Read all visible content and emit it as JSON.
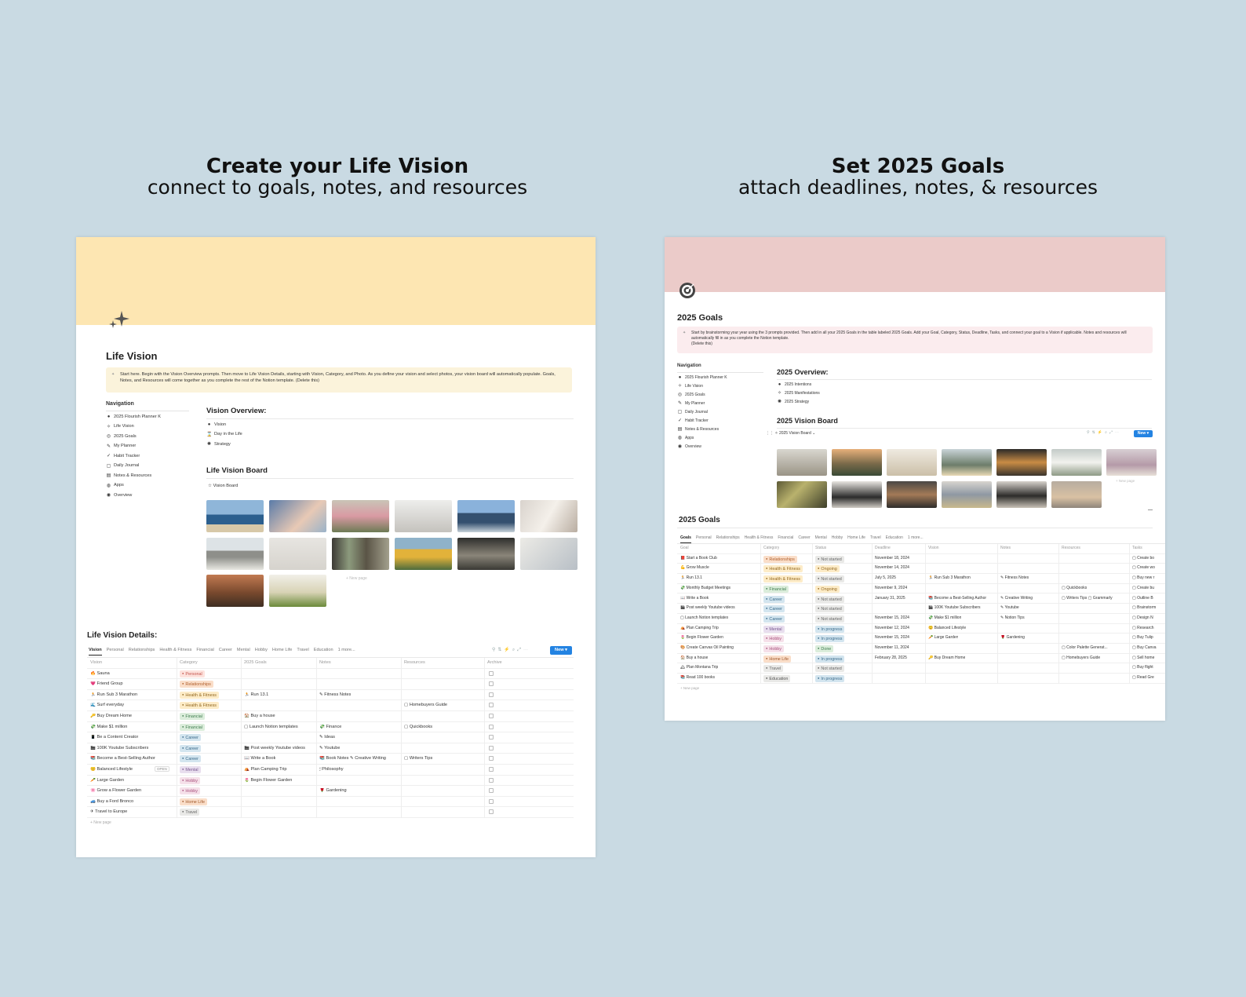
{
  "left_heading": {
    "title": "Create your Life Vision",
    "subtitle": "connect to goals, notes, and resources"
  },
  "right_heading": {
    "title": "Set 2025 Goals",
    "subtitle": "attach deadlines, notes, & resources"
  },
  "colors": {
    "cover_left": "#fde6b2",
    "cover_right": "#ebcbc9",
    "callout_left": "#fbf3db",
    "callout_right": "#fbecee",
    "accent": "#2383e2"
  },
  "tag_colors": {
    "Personal": {
      "bg": "#fde2dd",
      "fg": "#c4554d"
    },
    "Relationships": {
      "bg": "#fadec9",
      "fg": "#b0602e"
    },
    "Health & Fitness": {
      "bg": "#fdecc8",
      "fg": "#946922"
    },
    "Financial": {
      "bg": "#dbeddb",
      "fg": "#3f7d4f"
    },
    "Career": {
      "bg": "#d3e5ef",
      "fg": "#3a6a8a"
    },
    "Mental": {
      "bg": "#e8deee",
      "fg": "#7b5a92"
    },
    "Hobby": {
      "bg": "#f5e0e9",
      "fg": "#a9527e"
    },
    "Home Life": {
      "bg": "#fadec9",
      "fg": "#a0592c"
    },
    "Travel": {
      "bg": "#e9e9e7",
      "fg": "#666"
    },
    "Education": {
      "bg": "#e9e9e7",
      "fg": "#555"
    },
    "Not started": {
      "bg": "#e9e9e7",
      "fg": "#666"
    },
    "Ongoing": {
      "bg": "#fdecc8",
      "fg": "#946922"
    },
    "In progress": {
      "bg": "#d3e5ef",
      "fg": "#3a6a8a"
    },
    "Done": {
      "bg": "#dbeddb",
      "fg": "#3f7d4f"
    }
  },
  "left": {
    "page_icon": "sparkles-icon",
    "title": "Life Vision",
    "callout": "Start here. Begin with the Vision Overview prompts. Then move to Life Vision Details, starting with Vision, Category, and Photo. As you define your vision and select photos, your vision board will automatically populate. Goals, Notes, and Resources will come together as you complete the rest of the Notion template. (Delete this)",
    "nav_heading": "Navigation",
    "nav": [
      {
        "icon": "●",
        "label": "2025 Flourish Planner K"
      },
      {
        "icon": "✧",
        "label": "Life Vision"
      },
      {
        "icon": "◎",
        "label": "2025 Goals"
      },
      {
        "icon": "✎",
        "label": "My Planner"
      },
      {
        "icon": "✓",
        "label": "Habit Tracker"
      },
      {
        "icon": "▢",
        "label": "Daily Journal"
      },
      {
        "icon": "▤",
        "label": "Notes & Resources"
      },
      {
        "icon": "◍",
        "label": "Apps"
      },
      {
        "icon": "◉",
        "label": "Overview"
      }
    ],
    "overview_heading": "Vision Overview:",
    "overview_items": [
      {
        "icon": "●",
        "label": "Vision"
      },
      {
        "icon": "⌛",
        "label": "Day in the Life"
      },
      {
        "icon": "✺",
        "label": "Strategy"
      }
    ],
    "board_heading": "Life Vision Board",
    "board_view": "Vision Board",
    "new_page": "+ New page",
    "details_heading": "Life Vision Details:",
    "tabs": [
      "Vision",
      "Personal",
      "Relationships",
      "Health & Fitness",
      "Financial",
      "Career",
      "Mental",
      "Hobby",
      "Home Life",
      "Travel",
      "Education",
      "1 more..."
    ],
    "new_button": "New",
    "columns": [
      "Vision",
      "Category",
      "2025 Goals",
      "Notes",
      "Resources",
      "Archive"
    ],
    "rows": [
      {
        "icon": "🔥",
        "name": "Sauna",
        "category": "Personal",
        "goal": "",
        "notes": "",
        "resources": ""
      },
      {
        "icon": "💗",
        "name": "Friend Group",
        "category": "Relationships",
        "goal": "",
        "notes": "",
        "resources": ""
      },
      {
        "icon": "🏃",
        "name": "Run Sub 3 Marathon",
        "category": "Health & Fitness",
        "goal": "🏃 Run 13.1",
        "notes": "✎ Fitness Notes",
        "resources": ""
      },
      {
        "icon": "🌊",
        "name": "Surf everyday",
        "category": "Health & Fitness",
        "goal": "",
        "notes": "",
        "resources": "▢ Homebuyers Guide"
      },
      {
        "icon": "🔑",
        "name": "Buy Dream Home",
        "category": "Financial",
        "goal": "🏠 Buy a house",
        "notes": "",
        "resources": ""
      },
      {
        "icon": "💸",
        "name": "Make $1 million",
        "category": "Financial",
        "goal": "▢ Launch Notion templates",
        "notes": "💸 Finance",
        "resources": "▢ Quickbooks"
      },
      {
        "icon": "📱",
        "name": "Be a Content Creator",
        "category": "Career",
        "goal": "",
        "notes": "✎ Ideas",
        "resources": ""
      },
      {
        "icon": "🎬",
        "name": "100K Youtube Subscribers",
        "category": "Career",
        "goal": "🎬 Post weekly Youtube videos",
        "notes": "✎ Youtube",
        "resources": ""
      },
      {
        "icon": "📚",
        "name": "Become a Best-Selling Author",
        "category": "Career",
        "goal": "📖 Write a Book",
        "notes": "📚 Book Notes  ✎ Creative Writing",
        "resources": "▢ Writers Tips"
      },
      {
        "icon": "😊",
        "name": "Balanced Lifestyle",
        "category": "Mental",
        "goal": "⛺ Plan Camping Trip",
        "notes": "🕯 Philosophy",
        "resources": "",
        "open": "OPEN"
      },
      {
        "icon": "🥕",
        "name": "Large Garden",
        "category": "Hobby",
        "goal": "🌷 Begin Flower Garden",
        "notes": "",
        "resources": ""
      },
      {
        "icon": "🌸",
        "name": "Grow a Flower Garden",
        "category": "Hobby",
        "goal": "",
        "notes": "🌹 Gardening",
        "resources": ""
      },
      {
        "icon": "🚙",
        "name": "Buy a Ford Bronco",
        "category": "Home Life",
        "goal": "",
        "notes": "",
        "resources": ""
      },
      {
        "icon": "✈",
        "name": "Travel to Europe",
        "category": "Travel",
        "goal": "",
        "notes": "",
        "resources": ""
      }
    ]
  },
  "right": {
    "page_icon": "target-icon",
    "title": "2025 Goals",
    "callout": "Start by brainstorming your year using the 3 prompts provided. Then add in all your 2025 Goals in the table labeled 2025 Goals. Add your Goal, Category, Status, Deadline, Tasks, and connect your goal to a Vision if applicable. Notes and resources will automatically fill in as you complete the Notion template.",
    "callout_end": "(Delete this)",
    "nav_heading": "Navigation",
    "nav": [
      {
        "icon": "●",
        "label": "2025 Flourish Planner K"
      },
      {
        "icon": "✧",
        "label": "Life Vision"
      },
      {
        "icon": "◎",
        "label": "2025 Goals"
      },
      {
        "icon": "✎",
        "label": "My Planner"
      },
      {
        "icon": "▢",
        "label": "Daily Journal"
      },
      {
        "icon": "✓",
        "label": "Habit Tracker"
      },
      {
        "icon": "▤",
        "label": "Notes & Resources"
      },
      {
        "icon": "◍",
        "label": "Apps"
      },
      {
        "icon": "◉",
        "label": "Overview"
      }
    ],
    "overview_heading": "2025 Overview:",
    "overview_items": [
      {
        "icon": "●",
        "label": "2025 Intentions"
      },
      {
        "icon": "✧",
        "label": "2025 Manifestations"
      },
      {
        "icon": "✺",
        "label": "2025 Strategy"
      }
    ],
    "board_heading": "2025 Vision Board",
    "board_view": "2025 Vision Board",
    "new_button": "New",
    "new_page": "+ New page",
    "goals_heading": "2025 Goals",
    "tabs": [
      "Goals",
      "Personal",
      "Relationships",
      "Health & Fitness",
      "Financial",
      "Career",
      "Mental",
      "Hobby",
      "Home Life",
      "Travel",
      "Education",
      "1 more..."
    ],
    "columns": [
      "Goal",
      "Category",
      "Status",
      "Deadline",
      "Vision",
      "Notes",
      "Resources",
      "Tasks"
    ],
    "rows": [
      {
        "name": "Start a Book Club",
        "icon": "📕",
        "category": "Relationships",
        "status": "Not started",
        "deadline": "November 18, 2024",
        "vision": "",
        "notes": "",
        "resources": "",
        "tasks": "▢ Create bo"
      },
      {
        "name": "Grow Muscle",
        "icon": "💪",
        "category": "Health & Fitness",
        "status": "Ongoing",
        "deadline": "November 14, 2024",
        "vision": "",
        "notes": "",
        "resources": "",
        "tasks": "▢ Create wo"
      },
      {
        "name": "Run 13.1",
        "icon": "🏃",
        "category": "Health & Fitness",
        "status": "Not started",
        "deadline": "July 5, 2025",
        "vision": "🏃 Run Sub 3 Marathon",
        "notes": "✎ Fitness Notes",
        "resources": "",
        "tasks": "▢ Buy new r"
      },
      {
        "name": "Monthly Budget Meetings",
        "icon": "💸",
        "category": "Financial",
        "status": "Ongoing",
        "deadline": "November 9, 2024",
        "vision": "",
        "notes": "",
        "resources": "▢ Quickbooks",
        "tasks": "▢ Create bu"
      },
      {
        "name": "Write a Book",
        "icon": "📖",
        "category": "Career",
        "status": "Not started",
        "deadline": "January 31, 2025",
        "vision": "📚 Become a Best-Selling Author",
        "notes": "✎ Creative Writing",
        "resources": "▢ Writers Tips  ▢ Grammarly",
        "tasks": "▢ Outline B"
      },
      {
        "name": "Post weekly Youtube videos",
        "icon": "🎬",
        "category": "Career",
        "status": "Not started",
        "deadline": "",
        "vision": "🎬 100K Youtube Subscribers",
        "notes": "✎ Youtube",
        "resources": "",
        "tasks": "▢ Brainstorm"
      },
      {
        "name": "Launch Notion templates",
        "icon": "▢",
        "category": "Career",
        "status": "Not started",
        "deadline": "November 15, 2024",
        "vision": "💸 Make $1 million",
        "notes": "✎ Notion Tips",
        "resources": "",
        "tasks": "▢ Design N"
      },
      {
        "name": "Plan Camping Trip",
        "icon": "⛺",
        "category": "Mental",
        "status": "In progress",
        "deadline": "November 12, 2024",
        "vision": "😊 Balanced Lifestyle",
        "notes": "",
        "resources": "",
        "tasks": "▢ Research"
      },
      {
        "name": "Begin Flower Garden",
        "icon": "🌷",
        "category": "Hobby",
        "status": "In progress",
        "deadline": "November 15, 2024",
        "vision": "🥕 Large Garden",
        "notes": "🌹 Gardening",
        "resources": "",
        "tasks": "▢ Buy Tulip"
      },
      {
        "name": "Create Canvas Oil Painting",
        "icon": "🎨",
        "category": "Hobby",
        "status": "Done",
        "deadline": "November 11, 2024",
        "vision": "",
        "notes": "",
        "resources": "▢ Color Palette Generat...",
        "tasks": "▢ Buy Canva"
      },
      {
        "name": "Buy a house",
        "icon": "🏠",
        "category": "Home Life",
        "status": "In progress",
        "deadline": "February 28, 2025",
        "vision": "🔑 Buy Dream Home",
        "notes": "",
        "resources": "▢ Homebuyers Guide",
        "tasks": "▢ Sell home"
      },
      {
        "name": "Plan Montana Trip",
        "icon": "🏔",
        "category": "Travel",
        "status": "Not started",
        "deadline": "",
        "vision": "",
        "notes": "",
        "resources": "",
        "tasks": "▢ Buy flight"
      },
      {
        "name": "Read 100 books",
        "icon": "📚",
        "category": "Education",
        "status": "In progress",
        "deadline": "",
        "vision": "",
        "notes": "",
        "resources": "",
        "tasks": "▢ Read Gre"
      }
    ]
  }
}
